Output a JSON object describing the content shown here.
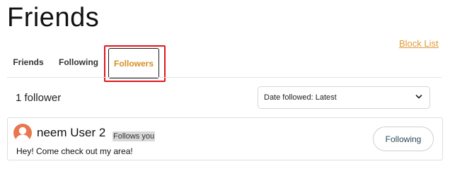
{
  "page": {
    "title": "Friends"
  },
  "block_list": {
    "label": "Block List"
  },
  "tabs": [
    {
      "label": "Friends"
    },
    {
      "label": "Following"
    },
    {
      "label": "Followers"
    }
  ],
  "list_header": {
    "count_text": "1 follower",
    "sort": {
      "selected": "Date followed: Latest"
    }
  },
  "followers": [
    {
      "name": "neem User 2",
      "badge": "Follows you",
      "bio": "Hey! Come check out my area!",
      "button_label": "Following",
      "avatar_color": "#e9764f"
    }
  ],
  "colors": {
    "accent": "#d88d22",
    "link": "#e29a38",
    "highlight_box": "#e0161d",
    "button_text": "#2c4a57"
  }
}
